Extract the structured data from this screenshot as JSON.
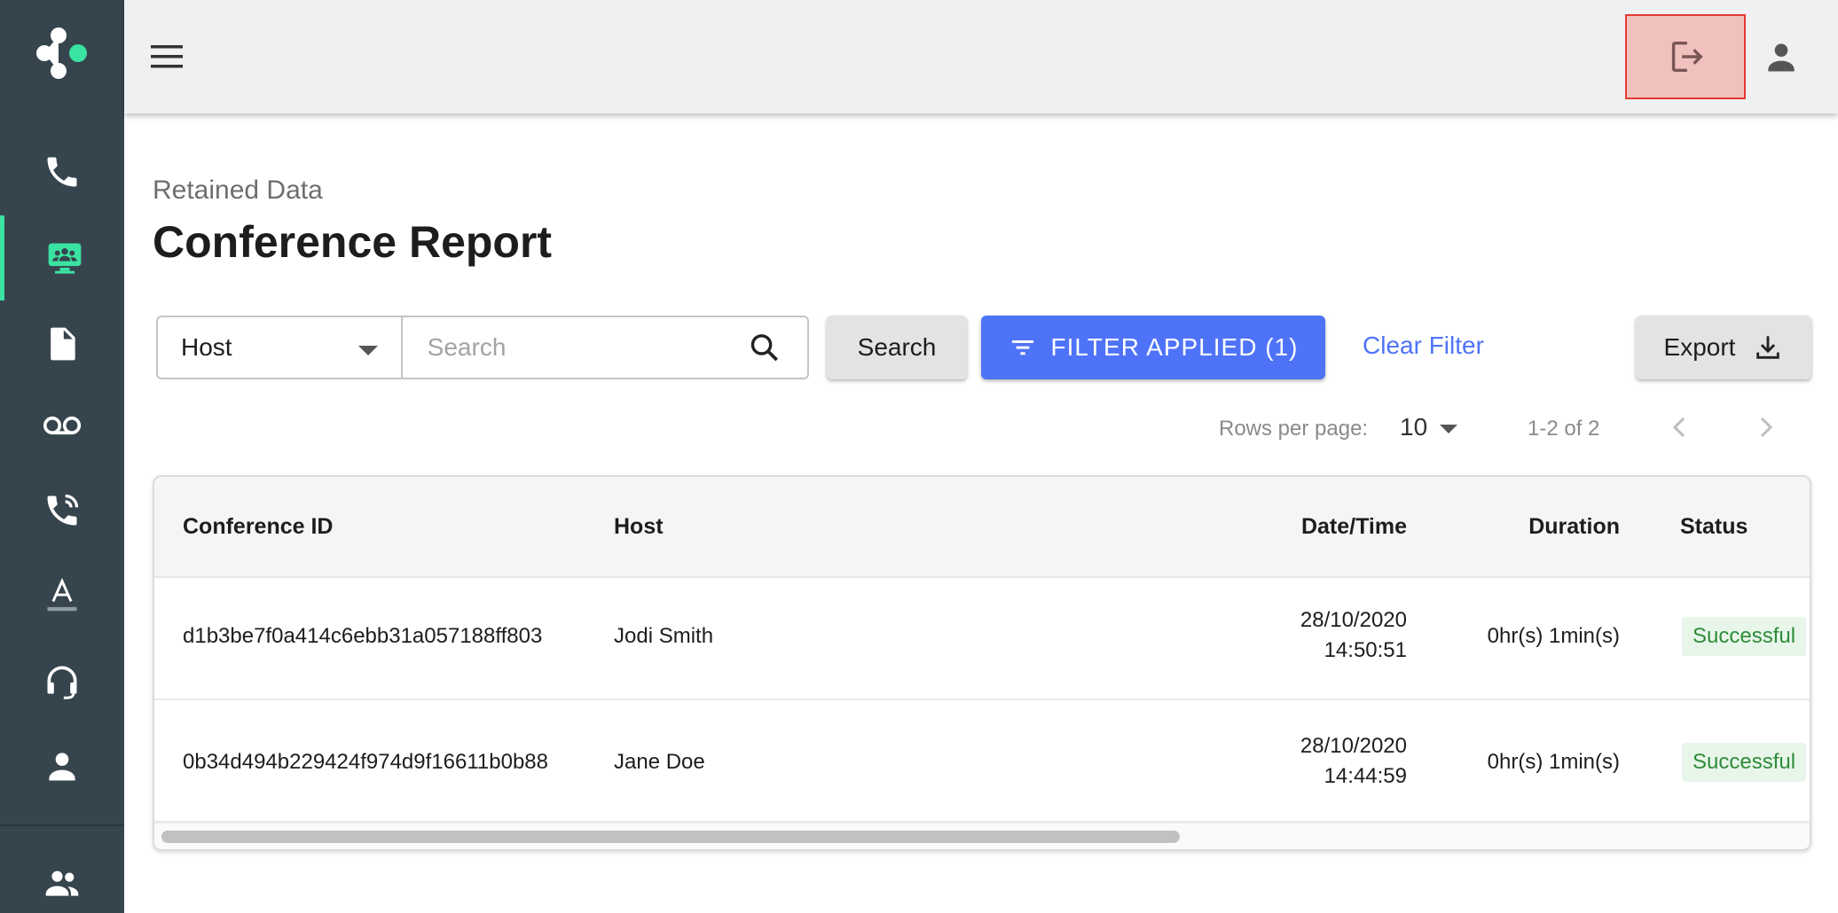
{
  "header": {
    "menu_icon": "hamburger-menu-icon",
    "logout_icon": "logout-icon",
    "user_icon": "account-icon",
    "highlight_color": "#e53935"
  },
  "sidebar": {
    "accent_color": "#3be3a2",
    "items": [
      {
        "icon": "phone-icon"
      },
      {
        "icon": "conference-icon",
        "active": true
      },
      {
        "icon": "document-icon"
      },
      {
        "icon": "voicemail-icon"
      },
      {
        "icon": "call-forward-icon"
      },
      {
        "icon": "text-format-icon"
      },
      {
        "icon": "headset-icon"
      },
      {
        "icon": "person-icon"
      },
      {
        "icon": "group-icon"
      }
    ]
  },
  "page": {
    "subtitle": "Retained Data",
    "title": "Conference Report"
  },
  "filters": {
    "field_select_value": "Host",
    "search_placeholder": "Search",
    "search_button": "Search",
    "filter_button": "FILTER APPLIED (1)",
    "clear_filter": "Clear Filter",
    "export_button": "Export",
    "accent_color": "#4f73f8"
  },
  "pagination": {
    "rows_label": "Rows per page:",
    "rows_value": "10",
    "range": "1-2 of 2"
  },
  "table": {
    "columns": [
      "Conference ID",
      "Host",
      "Date/Time",
      "Duration",
      "Status"
    ],
    "rows": [
      {
        "id": "d1b3be7f0a414c6ebb31a057188ff803",
        "host": "Jodi Smith",
        "date": "28/10/2020",
        "time": "14:50:51",
        "duration": "0hr(s) 1min(s)",
        "status": "Successful"
      },
      {
        "id": "0b34d494b229424f974d9f16611b0b88",
        "host": "Jane Doe",
        "date": "28/10/2020",
        "time": "14:44:59",
        "duration": "0hr(s) 1min(s)",
        "status": "Successful"
      }
    ],
    "status_color": "#2e8b3a"
  }
}
